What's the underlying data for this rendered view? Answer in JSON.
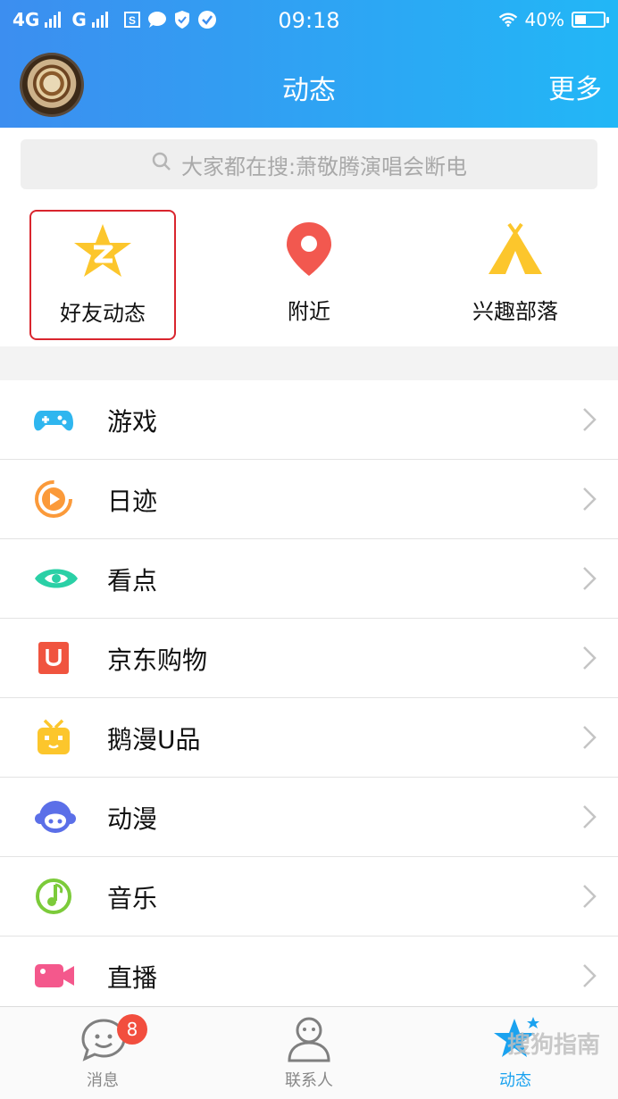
{
  "status_bar": {
    "network1": "4G",
    "network2": "G",
    "time": "09:18",
    "battery_text": "40%",
    "battery_level": 0.4
  },
  "header": {
    "title": "动态",
    "more_label": "更多"
  },
  "search": {
    "placeholder": "大家都在搜:萧敬腾演唱会断电"
  },
  "top_tiles": [
    {
      "label": "好友动态",
      "icon": "qzone-star-icon",
      "selected": true
    },
    {
      "label": "附近",
      "icon": "location-pin-icon"
    },
    {
      "label": "兴趣部落",
      "icon": "tent-icon"
    }
  ],
  "list_items": [
    {
      "label": "游戏",
      "icon": "gamepad-icon"
    },
    {
      "label": "日迹",
      "icon": "play-record-icon"
    },
    {
      "label": "看点",
      "icon": "eye-icon"
    },
    {
      "label": "京东购物",
      "icon": "jd-u-icon"
    },
    {
      "label": "鹅漫U品",
      "icon": "tv-box-icon"
    },
    {
      "label": "动漫",
      "icon": "anime-face-icon"
    },
    {
      "label": "音乐",
      "icon": "music-note-icon"
    },
    {
      "label": "直播",
      "icon": "video-camera-icon"
    }
  ],
  "tab_bar": {
    "tabs": [
      {
        "label": "消息",
        "icon": "smile-chat-icon",
        "badge": "8"
      },
      {
        "label": "联系人",
        "icon": "person-icon"
      },
      {
        "label": "动态",
        "icon": "star-icon",
        "active": true
      }
    ]
  },
  "watermark": "搜狗指南",
  "colors": {
    "header_start": "#3c8ef0",
    "header_end": "#22b7f6",
    "highlight_border": "#d9252e",
    "active_tab": "#1aa2ef",
    "badge": "#f24e3e"
  }
}
